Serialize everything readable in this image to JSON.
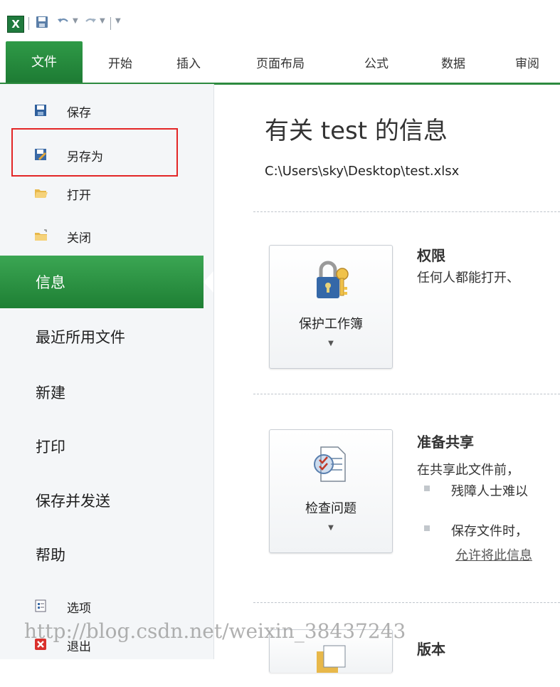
{
  "toolbar": {
    "app_icon_glyph": "X",
    "icons": [
      "excel-icon",
      "save-icon",
      "undo-icon",
      "redo-icon",
      "customize-icon"
    ]
  },
  "tabs": [
    {
      "label": "文件",
      "active": true
    },
    {
      "label": "开始"
    },
    {
      "label": "插入"
    },
    {
      "label": "页面布局"
    },
    {
      "label": "公式"
    },
    {
      "label": "数据"
    },
    {
      "label": "审阅"
    }
  ],
  "nav": {
    "quick": [
      {
        "label": "保存",
        "icon": "save-icon"
      },
      {
        "label": "另存为",
        "icon": "save-as-icon",
        "highlighted": true
      },
      {
        "label": "打开",
        "icon": "open-folder-icon"
      },
      {
        "label": "关闭",
        "icon": "close-folder-icon"
      }
    ],
    "items": [
      {
        "label": "信息",
        "active": true
      },
      {
        "label": "最近所用文件"
      },
      {
        "label": "新建"
      },
      {
        "label": "打印"
      },
      {
        "label": "保存并发送"
      },
      {
        "label": "帮助"
      }
    ],
    "bottom": [
      {
        "label": "选项",
        "icon": "options-icon"
      },
      {
        "label": "退出",
        "icon": "exit-icon"
      }
    ]
  },
  "main": {
    "title": "有关 test 的信息",
    "path": "C:\\Users\\sky\\Desktop\\test.xlsx",
    "sections": [
      {
        "button_label": "保护工作簿",
        "button_icon": "lock-key-icon",
        "heading": "权限",
        "text": "任何人都能打开、"
      },
      {
        "button_label": "检查问题",
        "button_icon": "inspect-document-icon",
        "heading": "准备共享",
        "text": "在共享此文件前，",
        "bullets": [
          "残障人士难以",
          "保存文件时，"
        ],
        "link": "允许将此信息"
      },
      {
        "heading": "版本"
      }
    ],
    "dropdown_glyph": "▼"
  },
  "watermark": "http://blog.csdn.net/weixin_38437243",
  "colors": {
    "accent_green": "#1e7f34",
    "highlight_red": "#e32626"
  }
}
